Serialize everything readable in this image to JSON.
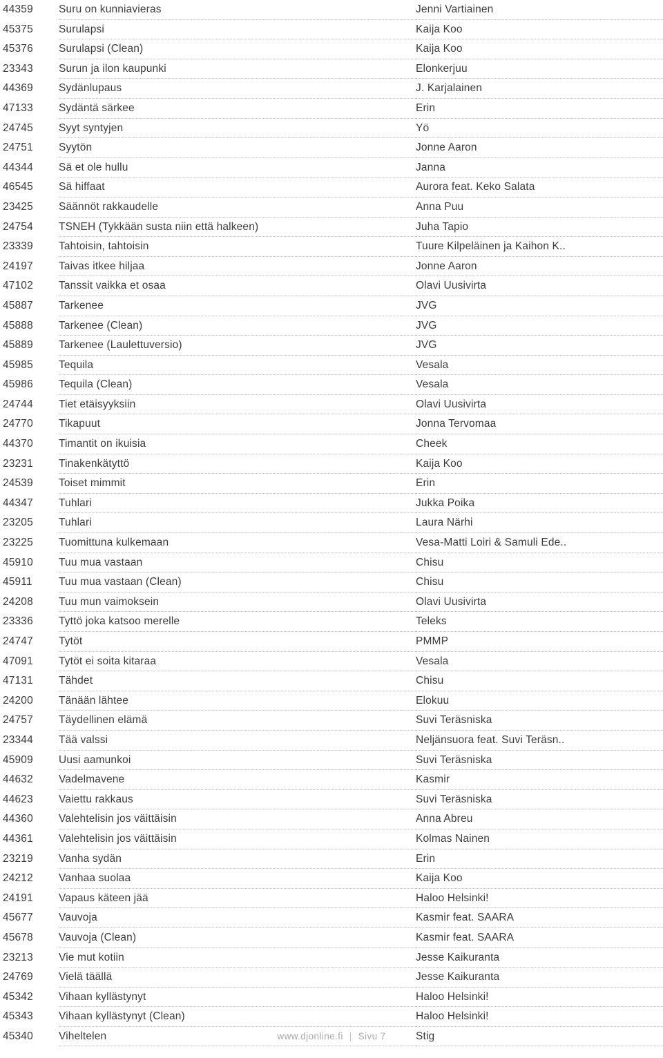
{
  "footer": {
    "site": "www.djonline.fi",
    "separator": "|",
    "page_label": "Sivu 7"
  },
  "table": {
    "rows": [
      {
        "id": "44359",
        "title": "Suru on kunniavieras",
        "artist": "Jenni Vartiainen"
      },
      {
        "id": "45375",
        "title": "Surulapsi",
        "artist": "Kaija Koo"
      },
      {
        "id": "45376",
        "title": "Surulapsi (Clean)",
        "artist": "Kaija Koo"
      },
      {
        "id": "23343",
        "title": "Surun ja ilon kaupunki",
        "artist": "Elonkerjuu"
      },
      {
        "id": "44369",
        "title": "Sydänlupaus",
        "artist": "J. Karjalainen"
      },
      {
        "id": "47133",
        "title": "Sydäntä särkee",
        "artist": "Erin"
      },
      {
        "id": "24745",
        "title": "Syyt syntyjen",
        "artist": "Yö"
      },
      {
        "id": "24751",
        "title": "Syytön",
        "artist": "Jonne Aaron"
      },
      {
        "id": "44344",
        "title": "Sä et ole hullu",
        "artist": "Janna"
      },
      {
        "id": "46545",
        "title": "Sä hiffaat",
        "artist": "Aurora feat. Keko Salata"
      },
      {
        "id": "23425",
        "title": "Säännöt rakkaudelle",
        "artist": "Anna Puu"
      },
      {
        "id": "24754",
        "title": "TSNEH (Tykkään susta niin että halkeen)",
        "artist": "Juha Tapio"
      },
      {
        "id": "23339",
        "title": "Tahtoisin, tahtoisin",
        "artist": "Tuure Kilpeläinen ja Kaihon K.."
      },
      {
        "id": "24197",
        "title": "Taivas itkee hiljaa",
        "artist": "Jonne Aaron"
      },
      {
        "id": "47102",
        "title": "Tanssit vaikka et osaa",
        "artist": "Olavi Uusivirta"
      },
      {
        "id": "45887",
        "title": "Tarkenee",
        "artist": "JVG"
      },
      {
        "id": "45888",
        "title": "Tarkenee (Clean)",
        "artist": "JVG"
      },
      {
        "id": "45889",
        "title": "Tarkenee (Laulettuversio)",
        "artist": "JVG"
      },
      {
        "id": "45985",
        "title": "Tequila",
        "artist": "Vesala"
      },
      {
        "id": "45986",
        "title": "Tequila (Clean)",
        "artist": "Vesala"
      },
      {
        "id": "24744",
        "title": "Tiet etäisyyksiin",
        "artist": "Olavi Uusivirta"
      },
      {
        "id": "24770",
        "title": "Tikapuut",
        "artist": "Jonna Tervomaa"
      },
      {
        "id": "44370",
        "title": "Timantit on ikuisia",
        "artist": "Cheek"
      },
      {
        "id": "23231",
        "title": "Tinakenkätyttö",
        "artist": "Kaija Koo"
      },
      {
        "id": "24539",
        "title": "Toiset mimmit",
        "artist": "Erin"
      },
      {
        "id": "44347",
        "title": "Tuhlari",
        "artist": "Jukka Poika"
      },
      {
        "id": "23205",
        "title": "Tuhlari",
        "artist": "Laura Närhi"
      },
      {
        "id": "23225",
        "title": "Tuomittuna kulkemaan",
        "artist": "Vesa-Matti Loiri & Samuli Ede.."
      },
      {
        "id": "45910",
        "title": "Tuu mua vastaan",
        "artist": "Chisu"
      },
      {
        "id": "45911",
        "title": "Tuu mua vastaan (Clean)",
        "artist": "Chisu"
      },
      {
        "id": "24208",
        "title": "Tuu mun vaimoksein",
        "artist": "Olavi Uusivirta"
      },
      {
        "id": "23336",
        "title": "Tyttö joka katsoo merelle",
        "artist": "Teleks"
      },
      {
        "id": "24747",
        "title": "Tytöt",
        "artist": "PMMP"
      },
      {
        "id": "47091",
        "title": "Tytöt ei soita kitaraa",
        "artist": "Vesala"
      },
      {
        "id": "47131",
        "title": "Tähdet",
        "artist": "Chisu"
      },
      {
        "id": "24200",
        "title": "Tänään lähtee",
        "artist": "Elokuu"
      },
      {
        "id": "24757",
        "title": "Täydellinen elämä",
        "artist": "Suvi Teräsniska"
      },
      {
        "id": "23344",
        "title": "Tää valssi",
        "artist": "Neljänsuora feat. Suvi Teräsn.."
      },
      {
        "id": "45909",
        "title": "Uusi aamunkoi",
        "artist": "Suvi Teräsniska"
      },
      {
        "id": "44632",
        "title": "Vadelmavene",
        "artist": "Kasmir"
      },
      {
        "id": "44623",
        "title": "Vaiettu rakkaus",
        "artist": "Suvi Teräsniska"
      },
      {
        "id": "44360",
        "title": "Valehtelisin jos väittäisin",
        "artist": "Anna Abreu"
      },
      {
        "id": "44361",
        "title": "Valehtelisin jos väittäisin",
        "artist": "Kolmas Nainen"
      },
      {
        "id": "23219",
        "title": "Vanha sydän",
        "artist": "Erin"
      },
      {
        "id": "24212",
        "title": "Vanhaa suolaa",
        "artist": "Kaija Koo"
      },
      {
        "id": "24191",
        "title": "Vapaus käteen jää",
        "artist": "Haloo Helsinki!"
      },
      {
        "id": "45677",
        "title": "Vauvoja",
        "artist": "Kasmir feat. SAARA"
      },
      {
        "id": "45678",
        "title": "Vauvoja (Clean)",
        "artist": "Kasmir feat. SAARA"
      },
      {
        "id": "23213",
        "title": "Vie mut kotiin",
        "artist": "Jesse Kaikuranta"
      },
      {
        "id": "24769",
        "title": "Vielä täällä",
        "artist": "Jesse Kaikuranta"
      },
      {
        "id": "45342",
        "title": "Vihaan kyllästynyt",
        "artist": "Haloo Helsinki!"
      },
      {
        "id": "45343",
        "title": "Vihaan kyllästynyt (Clean)",
        "artist": "Haloo Helsinki!"
      },
      {
        "id": "45340",
        "title": "Viheltelen",
        "artist": "Stig"
      }
    ]
  }
}
